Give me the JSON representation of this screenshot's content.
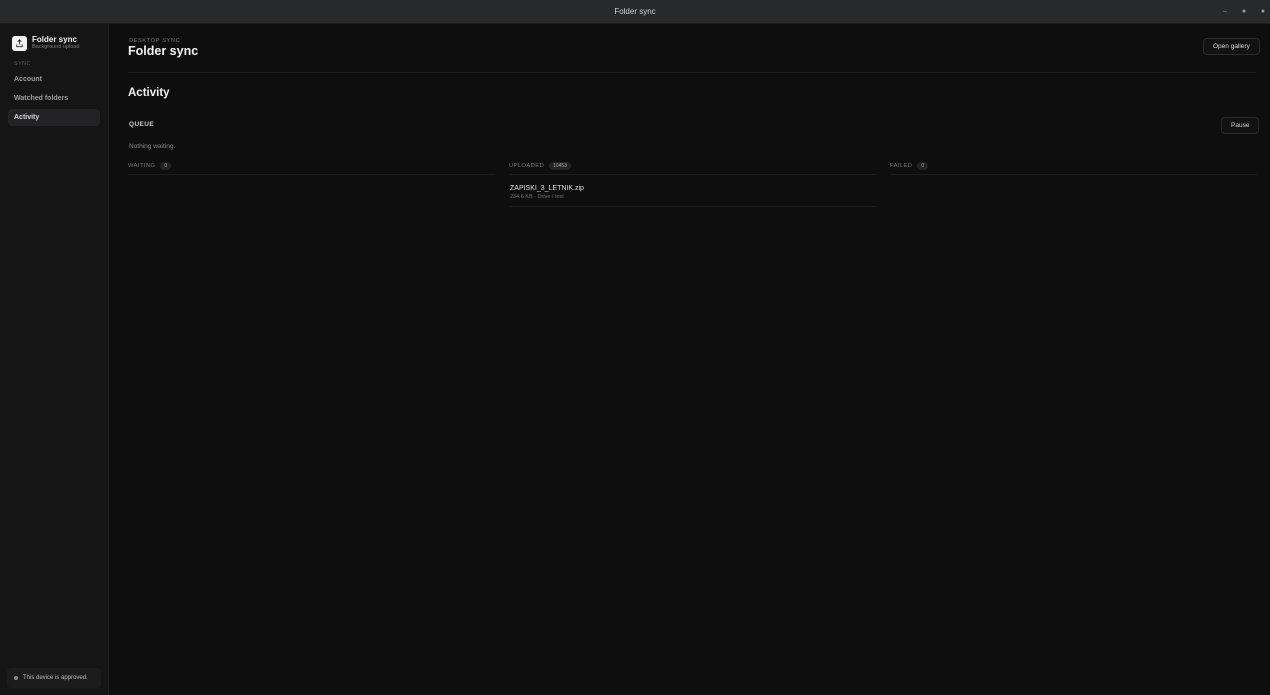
{
  "window": {
    "title": "Folder sync",
    "controls": [
      "–",
      "●",
      "●"
    ]
  },
  "sidebar": {
    "brand_name": "Folder sync",
    "brand_sub": "Background upload",
    "section_label": "SYNC",
    "items": [
      {
        "label": "Account"
      },
      {
        "label": "Watched folders"
      },
      {
        "label": "Activity"
      }
    ],
    "device_status": "This device is approved."
  },
  "header": {
    "eyebrow": "DESKTOP SYNC",
    "title": "Folder sync",
    "gallery_button": "Open gallery"
  },
  "activity": {
    "title": "Activity",
    "queue_label": "QUEUE",
    "pause_button": "Pause",
    "empty_text": "Nothing waiting.",
    "columns": {
      "waiting": {
        "label": "WAITING",
        "count": "0"
      },
      "uploaded": {
        "label": "UPLOADED",
        "count": "10453",
        "files": [
          {
            "name": "ZAPISKI_3_LETNIK.zip",
            "meta": "234.6 KB · Drive / test"
          }
        ]
      },
      "failed": {
        "label": "FAILED",
        "count": "0"
      }
    }
  },
  "colors": {
    "background": "#0e0e0f",
    "sidebar": "#151516",
    "active_item": "#232325",
    "text_primary": "#f3f3f3"
  }
}
